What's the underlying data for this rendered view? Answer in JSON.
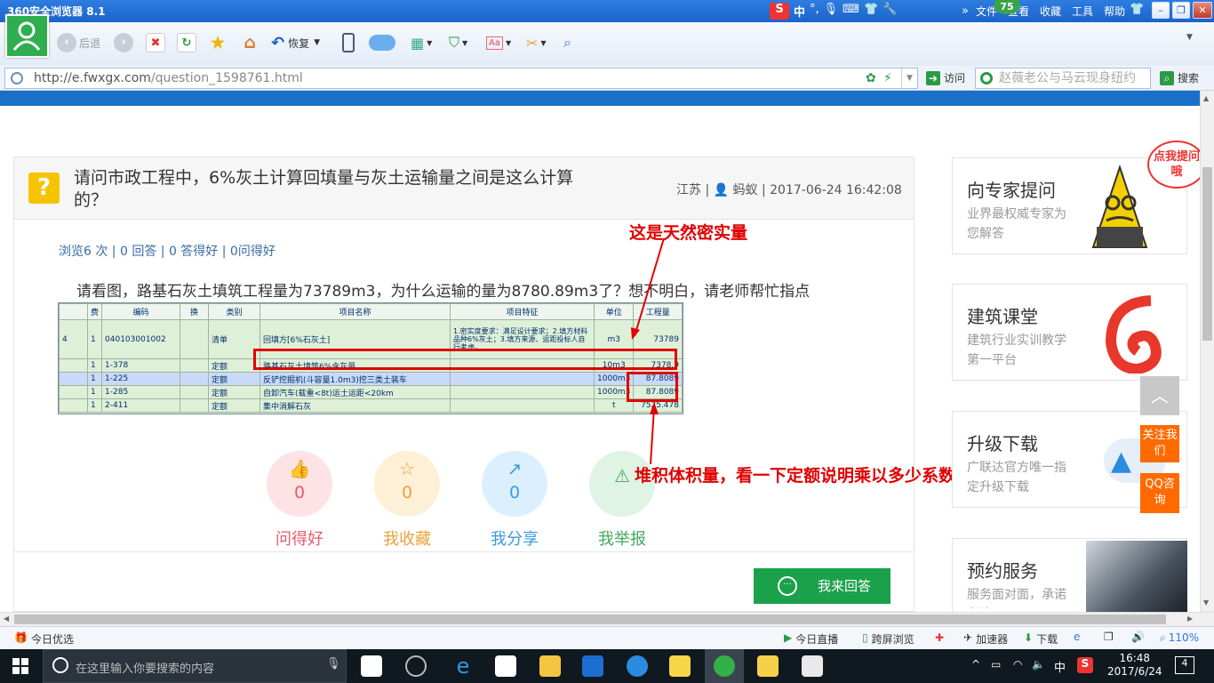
{
  "browser": {
    "title": "360安全浏览器 8.1",
    "menu": [
      "文件",
      "查看",
      "收藏",
      "工具",
      "帮助"
    ],
    "badge": "75",
    "ime": "中",
    "toolbar": {
      "back": "后退",
      "restore": "恢复"
    },
    "url": "http://e.fwxgx.com/question_1598761.html",
    "url_host": "http://e.fwxgx.com",
    "url_path": "/question_1598761.html",
    "visit": "访问",
    "search_placeholder": "赵薇老公与马云现身纽约",
    "search": "搜索"
  },
  "question": {
    "title": "请问市政工程中，6%灰土计算回填量与灰土运输量之间是这么计算的？",
    "region": "江苏",
    "author": "蚂蚁",
    "datetime": "2017-06-24 16:42:08",
    "stats": "浏览6 次 | 0 回答 | 0 答得好 | 0问得好",
    "body": "请看图，路基石灰土填筑工程量为73789m3，为什么运输的量为8780.89m3了？想不明白，请老师帮忙指点"
  },
  "table": {
    "headers": [
      "费",
      "编码",
      "换",
      "类别",
      "项目名称",
      "项目特征",
      "单位",
      "工程量"
    ],
    "rows": [
      {
        "seq": "4",
        "fee": "1",
        "code": "040103001002",
        "huan": "",
        "type": "清单",
        "name": "回填方[6%石灰土]",
        "feature": "1.密实度要求：满足设计要求；2.填方材料品种6%灰土；3.填方来源、运距投标人自行考虑。",
        "unit": "m3",
        "qty": "73789"
      },
      {
        "seq": "",
        "fee": "1",
        "code": "1-378",
        "huan": "",
        "type": "定额",
        "name": "路基石灰土填筑6%含灰量",
        "feature": "",
        "unit": "10m3",
        "qty": "7378.9"
      },
      {
        "seq": "",
        "fee": "1",
        "code": "1-225",
        "huan": "",
        "type": "定额",
        "name": "反铲挖掘机(斗容量1.0m3)挖三类土装车",
        "feature": "",
        "unit": "1000m3",
        "qty": "87.8089"
      },
      {
        "seq": "",
        "fee": "1",
        "code": "1-285",
        "huan": "",
        "type": "定额",
        "name": "自卸汽车(载重<8t)运土运距<20km",
        "feature": "",
        "unit": "1000m3",
        "qty": "87.8089"
      },
      {
        "seq": "",
        "fee": "1",
        "code": "2-411",
        "huan": "",
        "type": "定额",
        "name": "集中消解石灰",
        "feature": "",
        "unit": "t",
        "qty": "7525.478"
      }
    ]
  },
  "annotations": {
    "top": "这是天然密实量",
    "bottom": "堆积体积量，看一下定额说明乘以多少系数"
  },
  "actions": [
    {
      "label": "问得好",
      "count": "0",
      "color": "#e95a6a",
      "bg": "#fde3e6",
      "icon": "thumbs-up"
    },
    {
      "label": "我收藏",
      "count": "0",
      "color": "#e9a23b",
      "bg": "#fdf0d6",
      "icon": "star"
    },
    {
      "label": "我分享",
      "count": "0",
      "color": "#3c99dc",
      "bg": "#dcefff",
      "icon": "share"
    },
    {
      "label": "我举报",
      "count": "0",
      "color": "#41a85f",
      "bg": "#dff4e4",
      "icon": "warning"
    }
  ],
  "answer_button": "我来回答",
  "sidebar": [
    {
      "title": "向专家提问",
      "sub": "业界最权威专家为您解答",
      "bubble": "点我提问哦"
    },
    {
      "title": "建筑课堂",
      "sub": "建筑行业实训教学第一平台"
    },
    {
      "title": "升级下载",
      "sub": "广联达官方唯一指定升级下载"
    },
    {
      "title": "预约服务",
      "sub": "服务面对面，承诺必达"
    }
  ],
  "float": {
    "follow": "关注我们",
    "qq": "QQ咨询"
  },
  "status": {
    "left": "今日优选",
    "items": [
      "今日直播",
      "跨屏浏览",
      "加速器",
      "下载"
    ],
    "zoom": "110%"
  },
  "taskbar": {
    "search": "在这里输入你要搜索的内容",
    "ime": "中",
    "time": "16:48",
    "date": "2017/6/24",
    "notif": "4"
  }
}
